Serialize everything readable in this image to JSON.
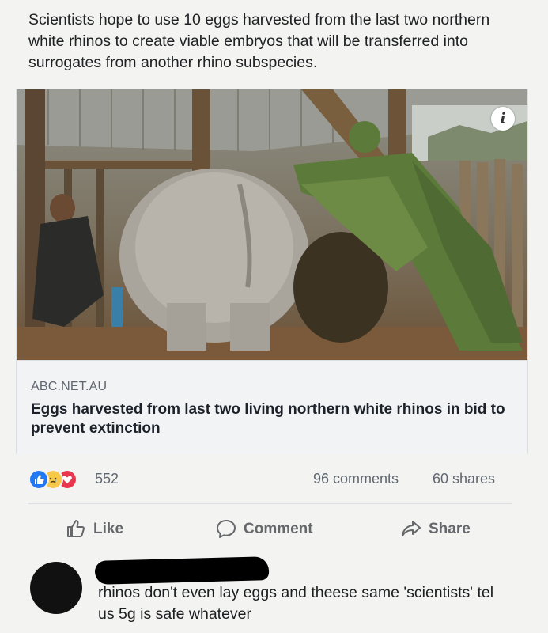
{
  "post": {
    "text": "Scientists hope to use 10 eggs harvested from the last two northern white rhinos to create viable embryos that will be transferred into surrogates from another rhino subspecies."
  },
  "link": {
    "domain": "ABC.NET.AU",
    "title": "Eggs harvested from last two living northern white rhinos in bid to prevent extinction",
    "image_icon": "info-icon",
    "info_glyph": "i"
  },
  "stats": {
    "reaction_icons": [
      "like-reaction-icon",
      "sad-reaction-icon",
      "love-reaction-icon"
    ],
    "reaction_count": "552",
    "comments": "96 comments",
    "shares": "60 shares"
  },
  "actions": {
    "like_label": "Like",
    "comment_label": "Comment",
    "share_label": "Share"
  },
  "comment": {
    "text": "rhinos don't even lay eggs and theese same 'scientists' tel us 5g is safe whatever"
  },
  "colors": {
    "like_blue": "#2078f4",
    "love_red": "#e8364f",
    "sad_yellow": "#f7c84a",
    "uniform_green": "#5c7a3a"
  }
}
